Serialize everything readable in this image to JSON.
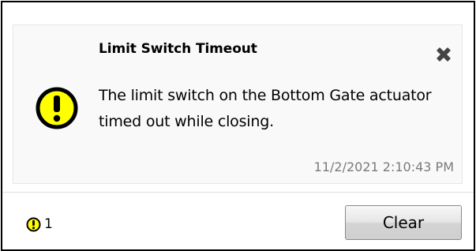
{
  "notification": {
    "title": "Limit Switch Timeout",
    "message": "The limit switch on the Bottom Gate actuator timed out while closing.",
    "timestamp": "11/2/2021 2:10:43 PM",
    "icon": "warning-icon",
    "close_icon": "close-x-icon"
  },
  "footer": {
    "warning_count": "1",
    "clear_label": "Clear"
  },
  "colors": {
    "warning_fill": "#ffff00",
    "warning_outline": "#000000",
    "timestamp": "#7a7a7a",
    "close_icon": "#444444"
  }
}
